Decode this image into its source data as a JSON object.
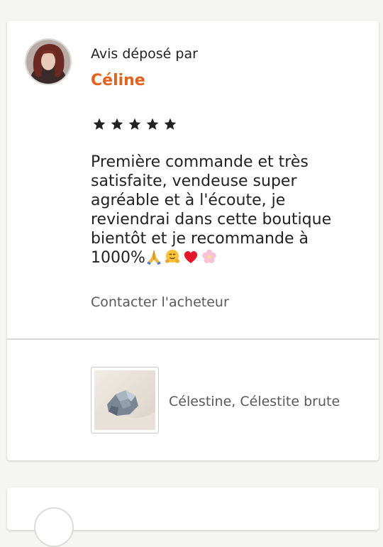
{
  "review": {
    "reviewed_by_label": "Avis déposé par",
    "reviewer_name": "Céline",
    "rating": 5,
    "rating_max": 5,
    "text_lines": [
      "Première commande et très",
      "satisfaite, vendeuse super",
      "agréable et à l'écoute, je",
      "reviendrai dans cette boutique",
      "bientôt et je recommande à"
    ],
    "text_last": "1000%",
    "emojis": [
      "folded-hands-emoji",
      "hugging-face-emoji",
      "red-heart-emoji",
      "cherry-blossom-emoji"
    ],
    "contact_label": "Contacter l'acheteur"
  },
  "product": {
    "title": "Célestine, Célestite brute",
    "image_icon": "mineral-photo"
  },
  "colors": {
    "accent": "#e5611a",
    "text": "#222222",
    "muted": "#595959",
    "background": "#f5f5f1"
  }
}
